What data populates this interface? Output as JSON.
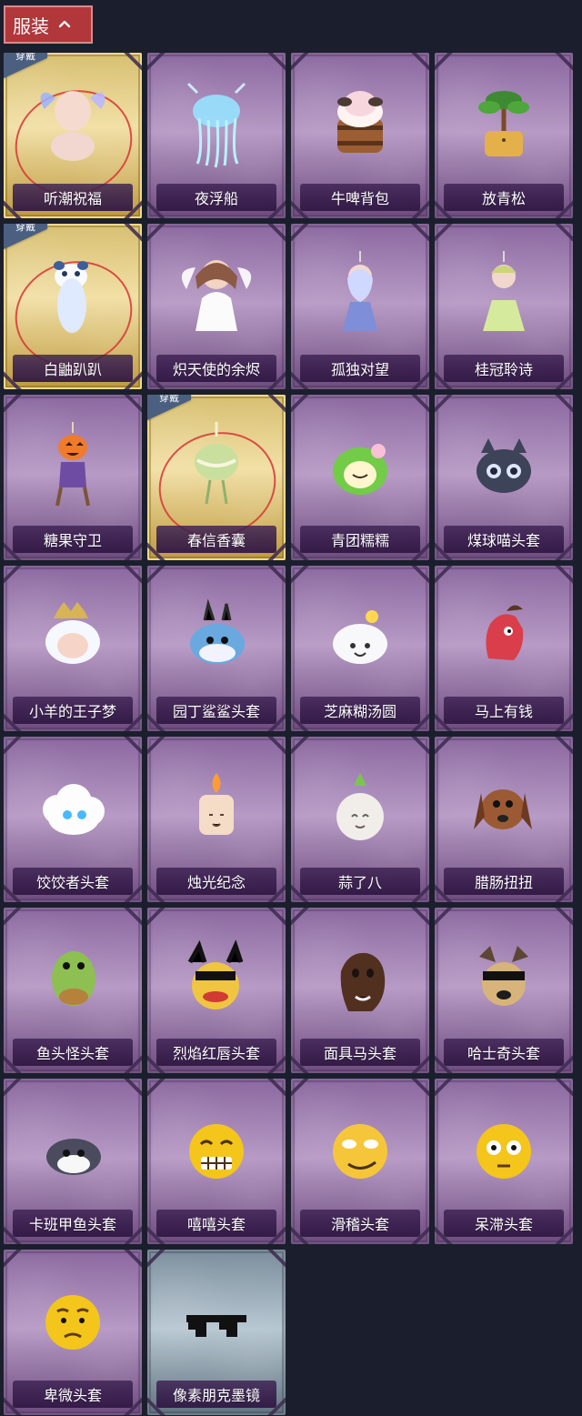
{
  "header": {
    "title": "服装",
    "arrow_icon": "chevron-up-icon"
  },
  "items": [
    {
      "label": "听潮祝福",
      "equipped": true,
      "tag": "穿戴",
      "style": "gold",
      "icon": "angel-doll-icon"
    },
    {
      "label": "夜浮船",
      "equipped": false,
      "style": "purple",
      "icon": "jellyfish-icon"
    },
    {
      "label": "牛啤背包",
      "equipped": false,
      "style": "purple",
      "icon": "cow-bucket-icon"
    },
    {
      "label": "放青松",
      "equipped": false,
      "style": "purple",
      "icon": "bonsai-icon"
    },
    {
      "label": "白鼬趴趴",
      "equipped": true,
      "tag": "穿戴",
      "style": "gold",
      "icon": "ermine-icon"
    },
    {
      "label": "炽天使的余烬",
      "equipped": false,
      "style": "purple",
      "icon": "angel-figure-icon"
    },
    {
      "label": "孤独对望",
      "equipped": false,
      "style": "purple",
      "icon": "charm-figure-icon"
    },
    {
      "label": "桂冠聆诗",
      "equipped": false,
      "style": "purple",
      "icon": "laurel-figure-icon"
    },
    {
      "label": "糖果守卫",
      "equipped": false,
      "style": "purple",
      "icon": "pumpkin-doll-icon"
    },
    {
      "label": "春信香囊",
      "equipped": true,
      "tag": "穿戴",
      "style": "gold",
      "icon": "sachet-icon"
    },
    {
      "label": "青团糯糯",
      "equipped": false,
      "style": "purple",
      "icon": "green-mochi-icon"
    },
    {
      "label": "煤球喵头套",
      "equipped": false,
      "style": "purple",
      "icon": "cat-head-icon"
    },
    {
      "label": "小羊的王子梦",
      "equipped": false,
      "style": "purple",
      "icon": "sheep-crown-icon"
    },
    {
      "label": "园丁鲨鲨头套",
      "equipped": false,
      "style": "purple",
      "icon": "shark-head-icon"
    },
    {
      "label": "芝麻糊汤圆",
      "equipped": false,
      "style": "purple",
      "icon": "dumpling-icon"
    },
    {
      "label": "马上有钱",
      "equipped": false,
      "style": "purple",
      "icon": "horse-head-icon"
    },
    {
      "label": "饺饺者头套",
      "equipped": false,
      "style": "purple",
      "icon": "cloud-dumpling-icon"
    },
    {
      "label": "烛光纪念",
      "equipped": false,
      "style": "purple",
      "icon": "candle-icon"
    },
    {
      "label": "蒜了八",
      "equipped": false,
      "style": "purple",
      "icon": "garlic-icon"
    },
    {
      "label": "腊肠扭扭",
      "equipped": false,
      "style": "purple",
      "icon": "dog-head-icon"
    },
    {
      "label": "鱼头怪头套",
      "equipped": false,
      "style": "purple",
      "icon": "fish-head-icon"
    },
    {
      "label": "烈焰红唇头套",
      "equipped": false,
      "style": "purple",
      "icon": "lips-head-icon"
    },
    {
      "label": "面具马头套",
      "equipped": false,
      "style": "purple",
      "icon": "horse-mask-icon"
    },
    {
      "label": "哈士奇头套",
      "equipped": false,
      "style": "purple",
      "icon": "husky-head-icon"
    },
    {
      "label": "卡班甲鱼头套",
      "equipped": false,
      "style": "purple",
      "icon": "turtle-head-icon"
    },
    {
      "label": "嘻嘻头套",
      "equipped": false,
      "style": "purple",
      "icon": "grin-face-icon"
    },
    {
      "label": "滑稽头套",
      "equipped": false,
      "style": "purple",
      "icon": "smirk-face-icon"
    },
    {
      "label": "呆滞头套",
      "equipped": false,
      "style": "purple",
      "icon": "stare-face-icon"
    },
    {
      "label": "卑微头套",
      "equipped": false,
      "style": "purple",
      "icon": "worried-face-icon"
    },
    {
      "label": "像素朋克墨镜",
      "equipped": false,
      "style": "silver",
      "icon": "pixel-sunglasses-icon"
    }
  ]
}
